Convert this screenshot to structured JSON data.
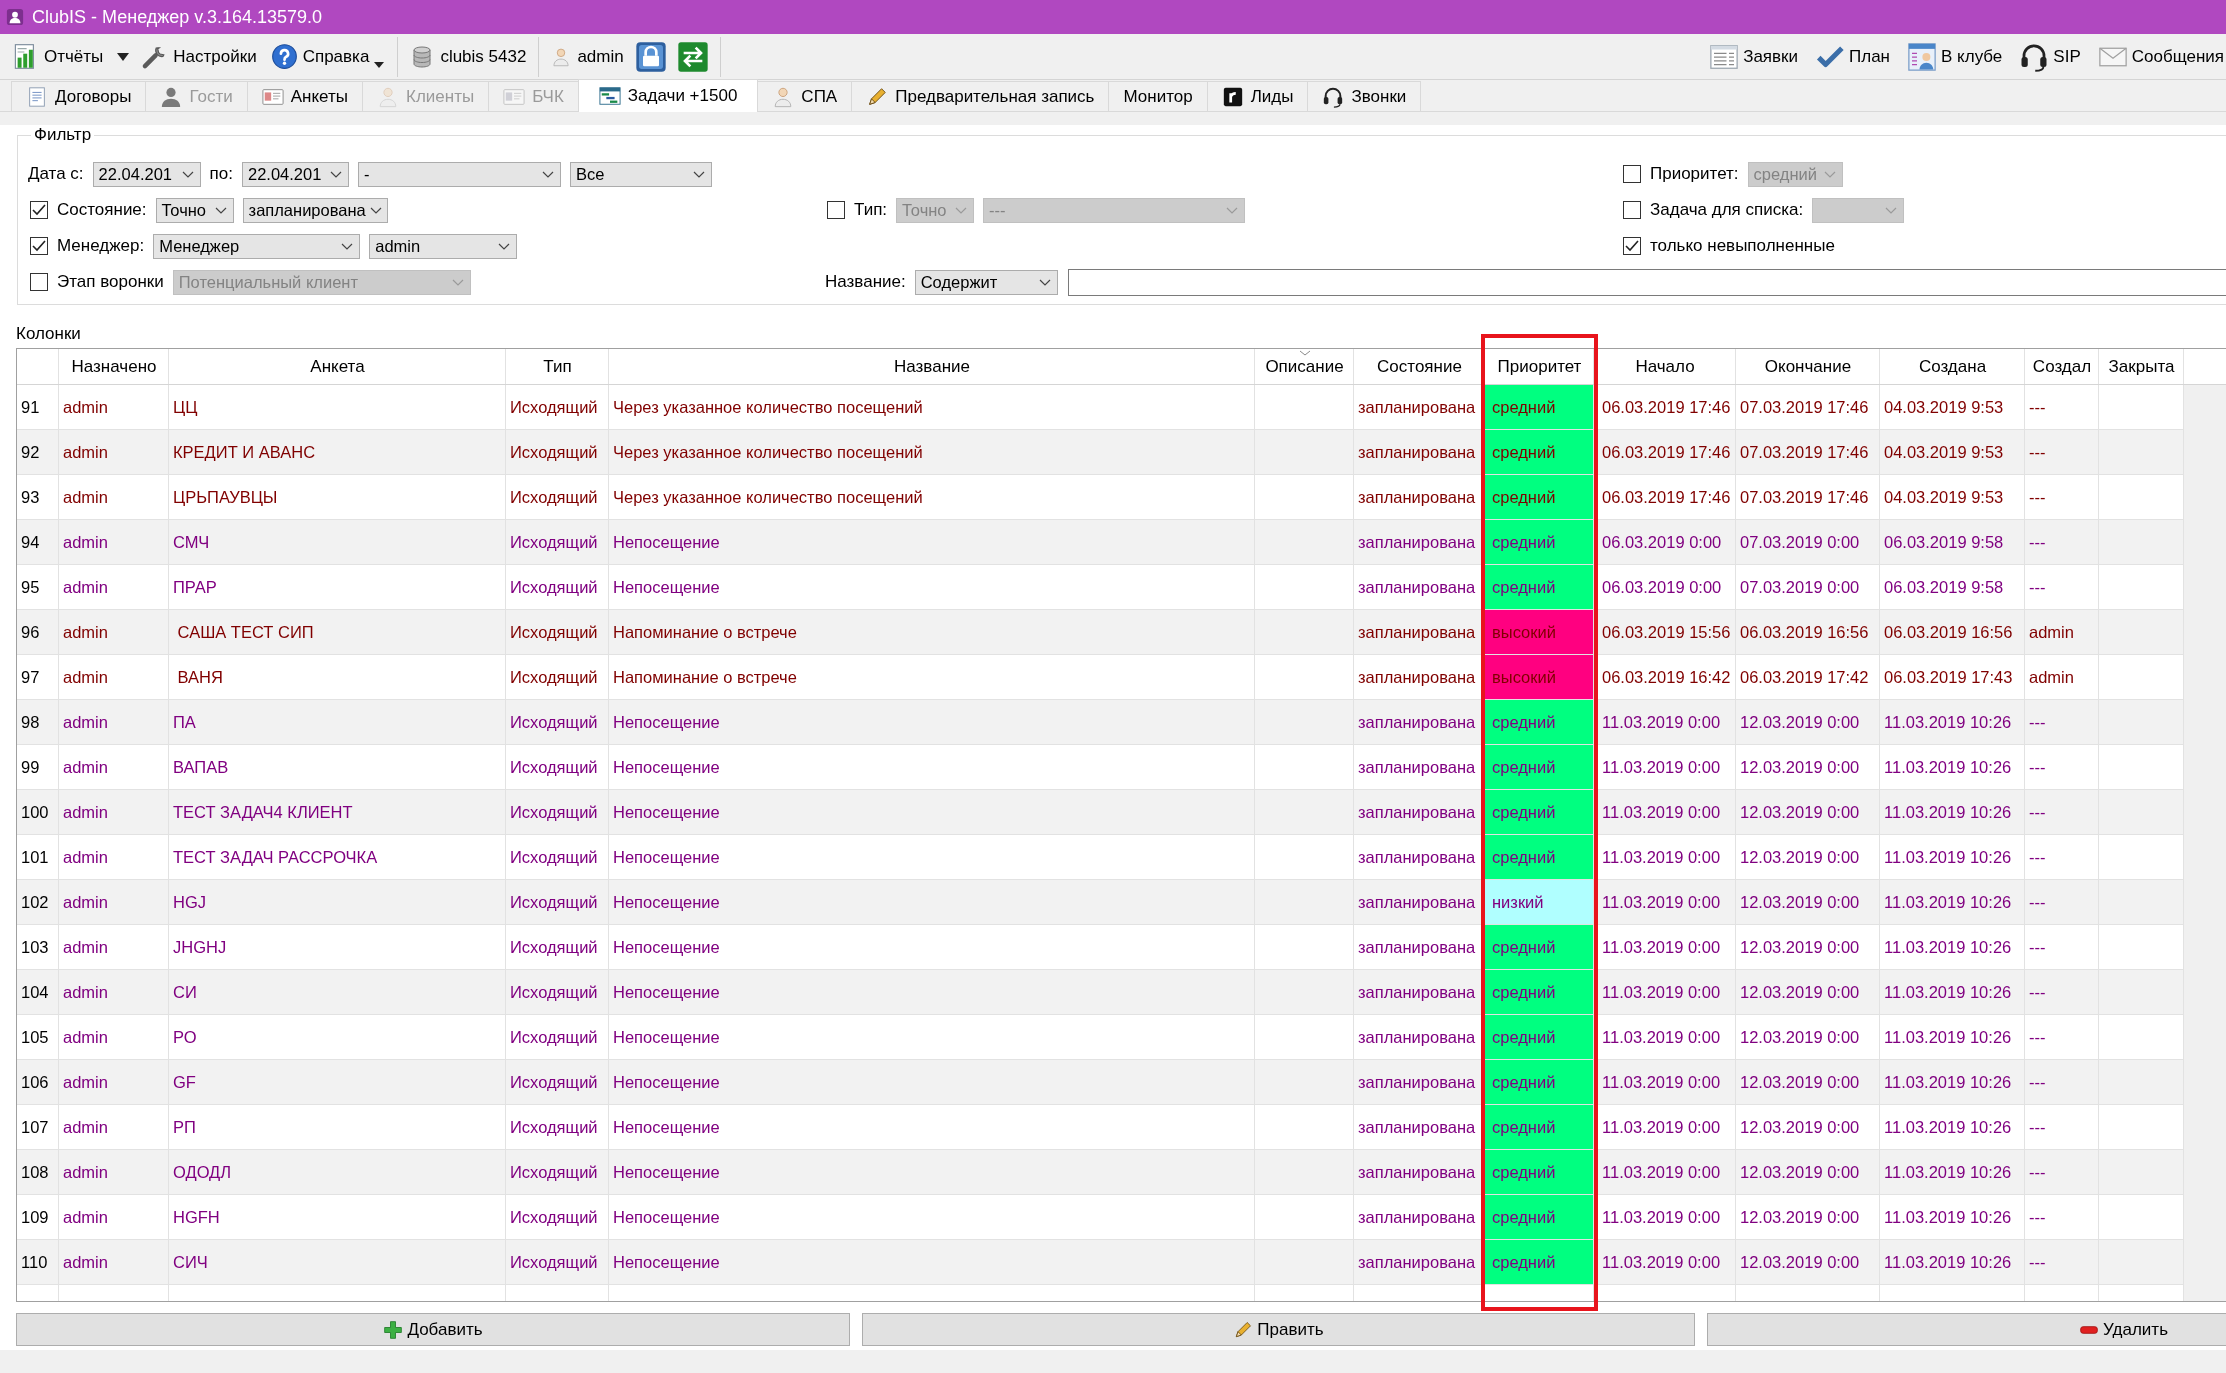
{
  "window": {
    "title": "ClubIS - Менеджер v.3.164.13579.0"
  },
  "toolbar": {
    "left": [
      {
        "kind": "button",
        "label": "Отчёты"
      },
      {
        "kind": "menu_arrow"
      },
      {
        "kind": "button",
        "label": "Настройки"
      },
      {
        "kind": "dropdown",
        "label": "Справка"
      },
      {
        "kind": "separator"
      },
      {
        "kind": "info",
        "label": "clubis 5432"
      },
      {
        "kind": "separator"
      },
      {
        "kind": "info",
        "label": "admin"
      },
      {
        "kind": "icon_button"
      },
      {
        "kind": "icon_button"
      },
      {
        "kind": "separator"
      }
    ],
    "right": [
      {
        "kind": "button",
        "label": "Заявки"
      },
      {
        "kind": "button",
        "label": "План"
      },
      {
        "kind": "button",
        "label": "В клубе"
      },
      {
        "kind": "button",
        "label": "SIP"
      },
      {
        "kind": "button",
        "label": "Сообщения"
      }
    ]
  },
  "tabs": [
    {
      "label": "Договоры",
      "selected": false,
      "disabled": false
    },
    {
      "label": "Гости",
      "selected": false,
      "disabled": true
    },
    {
      "label": "Анкеты",
      "selected": false,
      "disabled": false
    },
    {
      "label": "Клиенты",
      "selected": false,
      "disabled": true
    },
    {
      "label": "БЧК",
      "selected": false,
      "disabled": true
    },
    {
      "label": "Задачи +1500",
      "selected": true,
      "disabled": false
    },
    {
      "label": "СПА",
      "selected": false,
      "disabled": false
    },
    {
      "label": "Предварительная запись",
      "selected": false,
      "disabled": false
    },
    {
      "label": "Монитор",
      "selected": false,
      "disabled": false
    },
    {
      "label": "Лиды",
      "selected": false,
      "disabled": false
    },
    {
      "label": "Звонки",
      "selected": false,
      "disabled": false
    }
  ],
  "filter": {
    "title": "Фильтр",
    "rows": [
      {
        "left": [
          {
            "kind": "label",
            "text": "Дата с:"
          },
          {
            "kind": "combo",
            "value": "22.04.201",
            "disabled": false
          },
          {
            "kind": "label",
            "text": "по:"
          },
          {
            "kind": "combo",
            "value": "22.04.201",
            "disabled": false
          },
          {
            "kind": "combo",
            "value": "-",
            "disabled": false
          },
          {
            "kind": "combo",
            "value": "Все",
            "disabled": false
          }
        ],
        "right": [
          {
            "kind": "checkbox",
            "label": "Приоритет:",
            "checked": false
          },
          {
            "kind": "combo",
            "value": "средний",
            "disabled": true
          }
        ]
      },
      {
        "left": [
          {
            "kind": "checkbox",
            "label": "Состояние:",
            "checked": true
          },
          {
            "kind": "combo",
            "value": "Точно",
            "disabled": false
          },
          {
            "kind": "combo",
            "value": "запланирована",
            "disabled": false
          }
        ],
        "middle": [
          {
            "kind": "checkbox",
            "label": "Тип:",
            "checked": false
          },
          {
            "kind": "combo",
            "value": "Точно",
            "disabled": true
          },
          {
            "kind": "combo",
            "value": "---",
            "disabled": true
          }
        ],
        "right": [
          {
            "kind": "checkbox",
            "label": "Задача для списка:",
            "checked": false
          },
          {
            "kind": "combo",
            "disabled": true
          }
        ]
      },
      {
        "left": [
          {
            "kind": "checkbox",
            "label": "Менеджер:",
            "checked": true
          },
          {
            "kind": "combo",
            "value": "Менеджер",
            "disabled": false
          },
          {
            "kind": "combo",
            "value": "admin",
            "disabled": false
          }
        ],
        "right": [
          {
            "kind": "checkbox",
            "label": "только невыполненные",
            "checked": true
          }
        ]
      },
      {
        "left": [
          {
            "kind": "checkbox",
            "label": "Этап воронки",
            "checked": false
          },
          {
            "kind": "combo",
            "value": "Потенциальный клиент",
            "disabled": true
          }
        ],
        "middle": [
          {
            "kind": "label",
            "text": "Название:"
          },
          {
            "kind": "combo",
            "value": "Содержит",
            "disabled": false
          },
          {
            "kind": "input"
          }
        ]
      }
    ]
  },
  "table": {
    "title": "Колонки",
    "columns": [
      {
        "label": "Назначено",
        "sorted": false,
        "highlighted": false
      },
      {
        "label": "Анкета",
        "sorted": false,
        "highlighted": false
      },
      {
        "label": "Тип",
        "sorted": false,
        "highlighted": false
      },
      {
        "label": "Название",
        "sorted": false,
        "highlighted": false
      },
      {
        "label": "Описание",
        "sorted": true,
        "highlighted": false
      },
      {
        "label": "Состояние",
        "sorted": false,
        "highlighted": false
      },
      {
        "label": "Приоритет",
        "sorted": false,
        "highlighted": true
      },
      {
        "label": "Начало",
        "sorted": false,
        "highlighted": false
      },
      {
        "label": "Окончание",
        "sorted": false,
        "highlighted": false
      },
      {
        "label": "Создана",
        "sorted": false,
        "highlighted": false
      },
      {
        "label": "Создал",
        "sorted": false,
        "highlighted": false
      },
      {
        "label": "Закрыта",
        "sorted": false,
        "highlighted": false
      }
    ],
    "rows": [
      {
        "n": "91",
        "assigned": "admin",
        "profile": "ЦЦ",
        "type": "Исходящий",
        "name": "Через указанное количество посещений",
        "state": "запланирована",
        "priority": {
          "label": "средний",
          "color": "#00ff80"
        },
        "start": "06.03.2019 17:46",
        "end": "07.03.2019 17:46",
        "created": "04.03.2019 9:53",
        "author": "---",
        "color": "#800000"
      },
      {
        "n": "92",
        "assigned": "admin",
        "profile": "КРЕДИТ И АВАНС",
        "type": "Исходящий",
        "name": "Через указанное количество посещений",
        "state": "запланирована",
        "priority": {
          "label": "средний",
          "color": "#00ff80"
        },
        "start": "06.03.2019 17:46",
        "end": "07.03.2019 17:46",
        "created": "04.03.2019 9:53",
        "author": "---",
        "color": "#800000"
      },
      {
        "n": "93",
        "assigned": "admin",
        "profile": "ЦРЬПАУВЦЫ",
        "type": "Исходящий",
        "name": "Через указанное количество посещений",
        "state": "запланирована",
        "priority": {
          "label": "средний",
          "color": "#00ff80"
        },
        "start": "06.03.2019 17:46",
        "end": "07.03.2019 17:46",
        "created": "04.03.2019 9:53",
        "author": "---",
        "color": "#800000"
      },
      {
        "n": "94",
        "assigned": "admin",
        "profile": "СМЧ",
        "type": "Исходящий",
        "name": "Непосещение",
        "state": "запланирована",
        "priority": {
          "label": "средний",
          "color": "#00ff80"
        },
        "start": "06.03.2019 0:00",
        "end": "07.03.2019 0:00",
        "created": "06.03.2019 9:58",
        "author": "---",
        "color": "#800080"
      },
      {
        "n": "95",
        "assigned": "admin",
        "profile": "ПРАР",
        "type": "Исходящий",
        "name": "Непосещение",
        "state": "запланирована",
        "priority": {
          "label": "средний",
          "color": "#00ff80"
        },
        "start": "06.03.2019 0:00",
        "end": "07.03.2019 0:00",
        "created": "06.03.2019 9:58",
        "author": "---",
        "color": "#800080"
      },
      {
        "n": "96",
        "assigned": "admin",
        "profile": " САША ТЕСТ СИП",
        "type": "Исходящий",
        "name": "Напоминание о встрече",
        "state": "запланирована",
        "priority": {
          "label": "высокий",
          "color": "#ff0080"
        },
        "start": "06.03.2019 15:56",
        "end": "06.03.2019 16:56",
        "created": "06.03.2019 16:56",
        "author": "admin",
        "color": "#800000"
      },
      {
        "n": "97",
        "assigned": "admin",
        "profile": " ВАНЯ",
        "type": "Исходящий",
        "name": "Напоминание о встрече",
        "state": "запланирована",
        "priority": {
          "label": "высокий",
          "color": "#ff0080"
        },
        "start": "06.03.2019 16:42",
        "end": "06.03.2019 17:42",
        "created": "06.03.2019 17:43",
        "author": "admin",
        "color": "#800000"
      },
      {
        "n": "98",
        "assigned": "admin",
        "profile": "ПА",
        "type": "Исходящий",
        "name": "Непосещение",
        "state": "запланирована",
        "priority": {
          "label": "средний",
          "color": "#00ff80"
        },
        "start": "11.03.2019 0:00",
        "end": "12.03.2019 0:00",
        "created": "11.03.2019 10:26",
        "author": "---",
        "color": "#800080"
      },
      {
        "n": "99",
        "assigned": "admin",
        "profile": "ВАПАВ",
        "type": "Исходящий",
        "name": "Непосещение",
        "state": "запланирована",
        "priority": {
          "label": "средний",
          "color": "#00ff80"
        },
        "start": "11.03.2019 0:00",
        "end": "12.03.2019 0:00",
        "created": "11.03.2019 10:26",
        "author": "---",
        "color": "#800080"
      },
      {
        "n": "100",
        "assigned": "admin",
        "profile": "ТЕСТ ЗАДАЧ4 КЛИЕНТ",
        "type": "Исходящий",
        "name": "Непосещение",
        "state": "запланирована",
        "priority": {
          "label": "средний",
          "color": "#00ff80"
        },
        "start": "11.03.2019 0:00",
        "end": "12.03.2019 0:00",
        "created": "11.03.2019 10:26",
        "author": "---",
        "color": "#800080"
      },
      {
        "n": "101",
        "assigned": "admin",
        "profile": "ТЕСТ ЗАДАЧ РАССРОЧКА",
        "type": "Исходящий",
        "name": "Непосещение",
        "state": "запланирована",
        "priority": {
          "label": "средний",
          "color": "#00ff80"
        },
        "start": "11.03.2019 0:00",
        "end": "12.03.2019 0:00",
        "created": "11.03.2019 10:26",
        "author": "---",
        "color": "#800080"
      },
      {
        "n": "102",
        "assigned": "admin",
        "profile": "HGJ",
        "type": "Исходящий",
        "name": "Непосещение",
        "state": "запланирована",
        "priority": {
          "label": "низкий",
          "color": "#b0ffff"
        },
        "start": "11.03.2019 0:00",
        "end": "12.03.2019 0:00",
        "created": "11.03.2019 10:26",
        "author": "---",
        "color": "#800080"
      },
      {
        "n": "103",
        "assigned": "admin",
        "profile": "JHGHJ",
        "type": "Исходящий",
        "name": "Непосещение",
        "state": "запланирована",
        "priority": {
          "label": "средний",
          "color": "#00ff80"
        },
        "start": "11.03.2019 0:00",
        "end": "12.03.2019 0:00",
        "created": "11.03.2019 10:26",
        "author": "---",
        "color": "#800080"
      },
      {
        "n": "104",
        "assigned": "admin",
        "profile": "СИ",
        "type": "Исходящий",
        "name": "Непосещение",
        "state": "запланирована",
        "priority": {
          "label": "средний",
          "color": "#00ff80"
        },
        "start": "11.03.2019 0:00",
        "end": "12.03.2019 0:00",
        "created": "11.03.2019 10:26",
        "author": "---",
        "color": "#800080"
      },
      {
        "n": "105",
        "assigned": "admin",
        "profile": "РО",
        "type": "Исходящий",
        "name": "Непосещение",
        "state": "запланирована",
        "priority": {
          "label": "средний",
          "color": "#00ff80"
        },
        "start": "11.03.2019 0:00",
        "end": "12.03.2019 0:00",
        "created": "11.03.2019 10:26",
        "author": "---",
        "color": "#800080"
      },
      {
        "n": "106",
        "assigned": "admin",
        "profile": "GF",
        "type": "Исходящий",
        "name": "Непосещение",
        "state": "запланирована",
        "priority": {
          "label": "средний",
          "color": "#00ff80"
        },
        "start": "11.03.2019 0:00",
        "end": "12.03.2019 0:00",
        "created": "11.03.2019 10:26",
        "author": "---",
        "color": "#800080"
      },
      {
        "n": "107",
        "assigned": "admin",
        "profile": "РП",
        "type": "Исходящий",
        "name": "Непосещение",
        "state": "запланирована",
        "priority": {
          "label": "средний",
          "color": "#00ff80"
        },
        "start": "11.03.2019 0:00",
        "end": "12.03.2019 0:00",
        "created": "11.03.2019 10:26",
        "author": "---",
        "color": "#800080"
      },
      {
        "n": "108",
        "assigned": "admin",
        "profile": "ОДОДЛ",
        "type": "Исходящий",
        "name": "Непосещение",
        "state": "запланирована",
        "priority": {
          "label": "средний",
          "color": "#00ff80"
        },
        "start": "11.03.2019 0:00",
        "end": "12.03.2019 0:00",
        "created": "11.03.2019 10:26",
        "author": "---",
        "color": "#800080"
      },
      {
        "n": "109",
        "assigned": "admin",
        "profile": "HGFH",
        "type": "Исходящий",
        "name": "Непосещение",
        "state": "запланирована",
        "priority": {
          "label": "средний",
          "color": "#00ff80"
        },
        "start": "11.03.2019 0:00",
        "end": "12.03.2019 0:00",
        "created": "11.03.2019 10:26",
        "author": "---",
        "color": "#800080"
      },
      {
        "n": "110",
        "assigned": "admin",
        "profile": "СИЧ",
        "type": "Исходящий",
        "name": "Непосещение",
        "state": "запланирована",
        "priority": {
          "label": "средний",
          "color": "#00ff80"
        },
        "start": "11.03.2019 0:00",
        "end": "12.03.2019 0:00",
        "created": "11.03.2019 10:26",
        "author": "---",
        "color": "#800080"
      }
    ]
  },
  "actions": [
    {
      "label": "Добавить"
    },
    {
      "label": "Править"
    },
    {
      "label": "Удалить"
    }
  ]
}
